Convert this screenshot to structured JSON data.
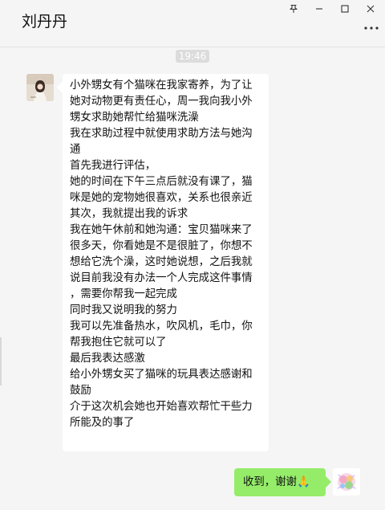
{
  "window": {
    "title": "刘丹丹",
    "controls": {
      "pin_icon": "pin-icon",
      "minimize_icon": "minimize-icon",
      "maximize_icon": "maximize-icon",
      "close_icon": "close-icon"
    },
    "more_icon": "more-icon"
  },
  "chat": {
    "timestamp": "19:46",
    "incoming": {
      "sender_avatar": "contact-avatar",
      "lines": [
        "小外甥女有个猫咪在我家寄养，为了让",
        "她对动物更有责任心，周一我向我小外",
        "甥女求助她帮忙给猫咪洗澡",
        "我在求助过程中就使用求助方法与她沟",
        "通",
        "首先我进行评估，",
        "她的时间在下午三点后就没有课了，猫",
        "咪是她的宠物她很喜欢，关系也很亲近",
        "其次，我就提出我的诉求",
        "我在她午休前和她沟通：宝贝猫咪来了",
        "很多天，你看她是不是很脏了，你想不",
        "想给它洗个澡，这时她说想，之后我就",
        "说目前我没有办法一个人完成这件事情",
        "，需要你帮我一起完成",
        "同时我又说明我的努力",
        "我可以先准备热水，吹风机，毛巾，你",
        "帮我抱住它就可以了",
        "最后我表达感激",
        "给小外甥女买了猫咪的玩具表达感谢和",
        "鼓励",
        "介于这次机会她也开始喜欢帮忙干些力",
        "所能及的事了"
      ]
    },
    "outgoing": {
      "text": "收到，谢谢🙏",
      "avatar": "self-avatar"
    }
  },
  "colors": {
    "background": "#f5f5f5",
    "incoming_bubble": "#ffffff",
    "outgoing_bubble": "#95ec69",
    "timestamp_badge": "#dcdcdc"
  }
}
